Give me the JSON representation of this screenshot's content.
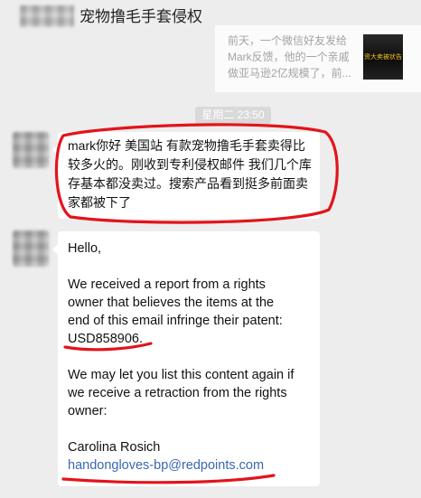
{
  "header": {
    "title": "宠物撸毛手套侵权"
  },
  "shared_card": {
    "lines": [
      "前天，一个微信好友发给",
      "Mark反馈，他的一个亲戚",
      "做亚马逊2亿规模了，前..."
    ],
    "thumbnail_text": "资大卖被状告"
  },
  "timestamp": "星期二 23:50",
  "message_1": {
    "lines": [
      "mark你好 美国站 有款宠物撸毛手套卖得比",
      "较多火的。刚收到专利侵权邮件 我们几个库",
      "存基本都没卖过。搜索产品看到挺多前面卖",
      "家都被下了"
    ]
  },
  "message_2": {
    "greeting": "Hello,",
    "paragraph_1": [
      "We received a report from a rights",
      "owner that believes the items at the",
      "end of this email infringe their patent:",
      "USD858906."
    ],
    "paragraph_2": [
      "We may let you list this content again if",
      "we receive a retraction from the rights",
      "owner:"
    ],
    "signature_name": "Carolina Rosich",
    "signature_email": "handongloves-bp@redpoints.com"
  },
  "colors": {
    "background": "#ededed",
    "bubble": "#ffffff",
    "annotation_red": "#e3141b",
    "link": "#3a67b1",
    "timestamp_pill": "#d9d9d9"
  }
}
